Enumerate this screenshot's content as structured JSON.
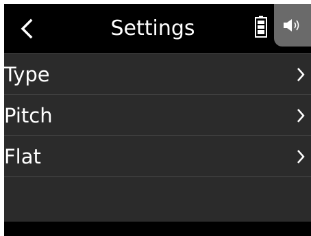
{
  "header": {
    "back_icon": "chevron-left-icon",
    "title": "Settings",
    "battery_icon": "battery-full-icon",
    "speaker_icon": "speaker-icon"
  },
  "menu": {
    "items": [
      {
        "label": "Type",
        "icon": "chevron-right-icon"
      },
      {
        "label": "Pitch",
        "icon": "chevron-right-icon"
      },
      {
        "label": "Flat",
        "icon": "chevron-right-icon"
      }
    ]
  },
  "colors": {
    "header_background": "#000000",
    "list_background": "#2b2b2b",
    "divider": "#4a4a4a",
    "speaker_button_background": "#6a6a6a",
    "text": "#ffffff"
  }
}
